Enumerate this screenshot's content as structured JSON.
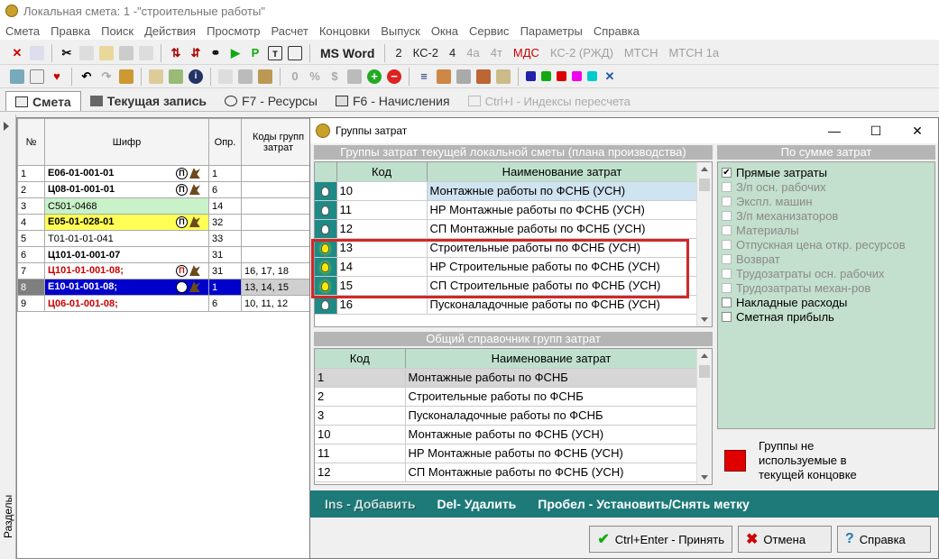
{
  "window": {
    "title": "Локальная смета: 1 -\"строительные работы\""
  },
  "menu": [
    "Смета",
    "Правка",
    "Поиск",
    "Действия",
    "Просмотр",
    "Расчет",
    "Концовки",
    "Выпуск",
    "Окна",
    "Сервис",
    "Параметры",
    "Справка"
  ],
  "toolbar": {
    "ms_word": "MS Word",
    "btn2": "2",
    "ks2": "КС-2",
    "btn4": "4",
    "btn4a": "4а",
    "btn4t": "4т",
    "mds": "МДС",
    "ks2rzd": "КС-2 (РЖД)",
    "mtsn": "МТСН",
    "mtsn1a": "МТСН 1а"
  },
  "tabs": {
    "smeta": "Смета",
    "tekushaya": "Текущая запись",
    "resursy": "F7 - Ресурсы",
    "nachisleniya": "F6 - Начисления",
    "indeksy": "Ctrl+I - Индексы пересчета"
  },
  "left_strip": {
    "label": "Разделы"
  },
  "grid": {
    "headers": {
      "no": "№",
      "shifr": "Шифр",
      "opr": "Опр.",
      "kody": "Коды групп затрат"
    },
    "rows": [
      {
        "no": "1",
        "shifr": "Е06-01-001-01",
        "opr": "1",
        "kody": "",
        "bg": "#ffffff",
        "color": "#000000",
        "bold": true,
        "icons": true
      },
      {
        "no": "2",
        "shifr": "Ц08-01-001-01",
        "opr": "6",
        "kody": "",
        "bg": "#ffffff",
        "color": "#000000",
        "bold": true,
        "icons": true
      },
      {
        "no": "3",
        "shifr": "С501-0468",
        "opr": "14",
        "kody": "",
        "bg": "#c9f2c9",
        "color": "#000000",
        "bold": false,
        "icons": false
      },
      {
        "no": "4",
        "shifr": "Е05-01-028-01",
        "opr": "32",
        "kody": "",
        "bg": "#ffff55",
        "color": "#000000",
        "bold": true,
        "icons": true
      },
      {
        "no": "5",
        "shifr": "Т01-01-01-041",
        "opr": "33",
        "kody": "",
        "bg": "#ffffff",
        "color": "#000000",
        "bold": false,
        "icons": false
      },
      {
        "no": "6",
        "shifr": "Ц101-01-001-07",
        "opr": "31",
        "kody": "",
        "bg": "#ffffff",
        "color": "#000000",
        "bold": true,
        "icons": false
      },
      {
        "no": "7",
        "shifr": "Ц101-01-001-08;",
        "opr": "31",
        "kody": "16, 17, 18",
        "bg": "#ffffff",
        "color": "#cc0000",
        "bold": true,
        "icons": true
      },
      {
        "no": "8",
        "shifr": "Е10-01-001-08;",
        "opr": "1",
        "kody": "13, 14, 15",
        "bg": "#0000cc",
        "color": "#ffffff",
        "bold": true,
        "icons": true
      },
      {
        "no": "9",
        "shifr": "Ц06-01-001-08;",
        "opr": "6",
        "kody": "10, 11, 12",
        "bg": "#ffffff",
        "color": "#cc0000",
        "bold": true,
        "icons": false
      }
    ]
  },
  "dialog": {
    "title": "Группы затрат",
    "top_header": "Группы затрат текущей локальной сметы (плана производства)",
    "top_cols": {
      "kod": "Код",
      "name": "Наименование затрат"
    },
    "top_rows": [
      {
        "kod": "10",
        "name": "Монтажные работы по ФСНБ (УСН)",
        "on": false
      },
      {
        "kod": "11",
        "name": "НР Монтажные работы по ФСНБ (УСН)",
        "on": false
      },
      {
        "kod": "12",
        "name": "СП Монтажные работы по ФСНБ (УСН)",
        "on": false
      },
      {
        "kod": "13",
        "name": "Строительные работы по ФСНБ (УСН)",
        "on": true
      },
      {
        "kod": "14",
        "name": "НР Строительные работы по ФСНБ (УСН)",
        "on": true
      },
      {
        "kod": "15",
        "name": "СП Строительные работы по ФСНБ (УСН)",
        "on": true
      },
      {
        "kod": "16",
        "name": "Пусконаладочные работы по ФСНБ (УСН)",
        "on": false
      }
    ],
    "bottom_header": "Общий справочник групп затрат",
    "bottom_cols": {
      "kod": "Код",
      "name": "Наименование затрат"
    },
    "bottom_rows": [
      {
        "kod": "1",
        "name": "Монтажные работы по ФСНБ"
      },
      {
        "kod": "2",
        "name": "Строительные работы по ФСНБ"
      },
      {
        "kod": "3",
        "name": "Пусконаладочные работы по ФСНБ"
      },
      {
        "kod": "10",
        "name": "Монтажные работы по ФСНБ (УСН)"
      },
      {
        "kod": "11",
        "name": "НР Монтажные работы по ФСНБ (УСН)"
      },
      {
        "kod": "12",
        "name": "СП Монтажные работы по ФСНБ (УСН)"
      }
    ],
    "right_header": "По сумме затрат",
    "checks": [
      {
        "label": "Прямые затраты",
        "checked": true,
        "enabled": true
      },
      {
        "label": "З/п осн. рабочих",
        "checked": false,
        "enabled": false
      },
      {
        "label": "Экспл. машин",
        "checked": false,
        "enabled": false
      },
      {
        "label": "З/п механизаторов",
        "checked": false,
        "enabled": false
      },
      {
        "label": "Материалы",
        "checked": false,
        "enabled": false
      },
      {
        "label": "Отпускная цена откр. ресурсов",
        "checked": false,
        "enabled": false
      },
      {
        "label": "Возврат",
        "checked": false,
        "enabled": false
      },
      {
        "label": "Трудозатраты осн. рабочих",
        "checked": false,
        "enabled": false
      },
      {
        "label": "Трудозатраты механ-ров",
        "checked": false,
        "enabled": false
      },
      {
        "label": "Накладные расходы",
        "checked": false,
        "enabled": true
      },
      {
        "label": "Сметная прибыль",
        "checked": false,
        "enabled": true
      }
    ],
    "legend": {
      "line1": "Группы не",
      "line2": "используемые в",
      "line3": "текущей концовке",
      "color": "#e00000"
    },
    "hotkeys": {
      "ins": "Ins - Добавить",
      "del": "Del- Удалить",
      "space": "Пробел - Установить/Снять метку"
    },
    "buttons": {
      "accept": "Ctrl+Enter - Принять",
      "cancel": "Отмена",
      "help": "Справка"
    }
  }
}
